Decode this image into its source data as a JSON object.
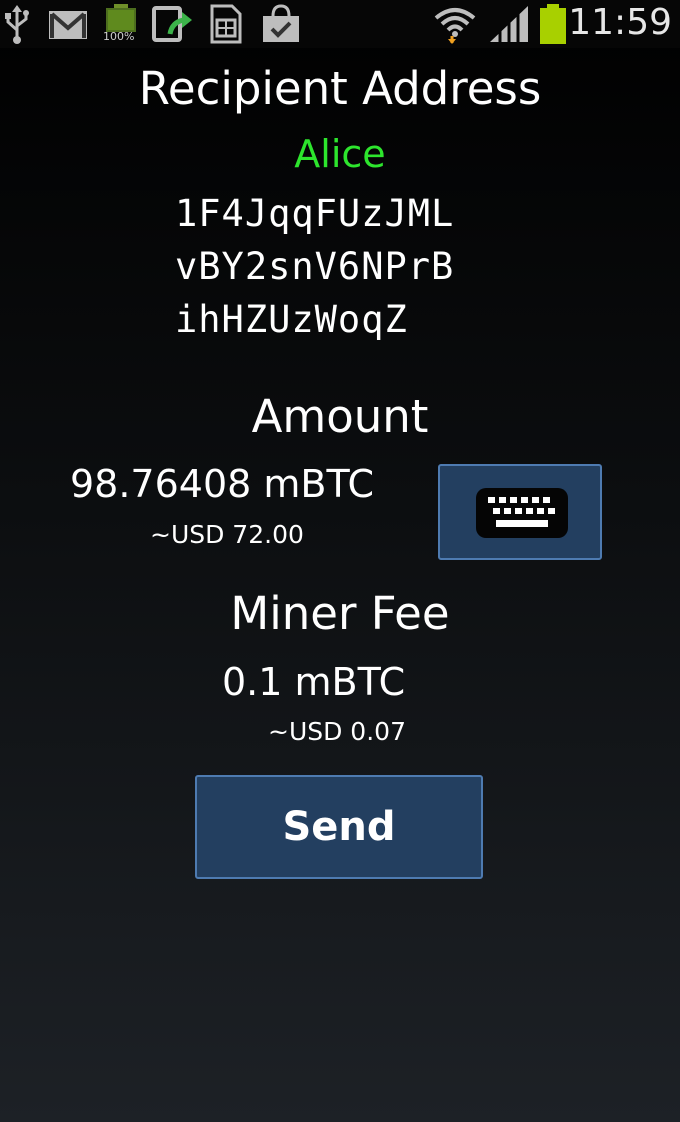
{
  "status_bar": {
    "icons": [
      "usb-icon",
      "gmail-icon",
      "battery-full-icon",
      "sync-icon",
      "sim-icon",
      "store-icon",
      "wifi-icon",
      "signal-icon",
      "battery-icon"
    ],
    "battery_percent": "100%",
    "time": "11:59"
  },
  "recipient": {
    "heading": "Recipient Address",
    "name": "Alice",
    "address_lines": [
      "1F4JqqFUzJML",
      "vBY2snV6NPrB",
      "ihHZUzWoqZ"
    ]
  },
  "amount": {
    "heading": "Amount",
    "value": "98.76408 mBTC",
    "usd": "~USD 72.00"
  },
  "miner_fee": {
    "heading": "Miner Fee",
    "value": "0.1 mBTC",
    "usd": "~USD 0.07"
  },
  "actions": {
    "send_label": "Send"
  },
  "colors": {
    "recipient_name": "#2de52d",
    "button_fill": "#233f60",
    "button_border": "#4e7bb1",
    "battery_green": "#a8d000"
  }
}
